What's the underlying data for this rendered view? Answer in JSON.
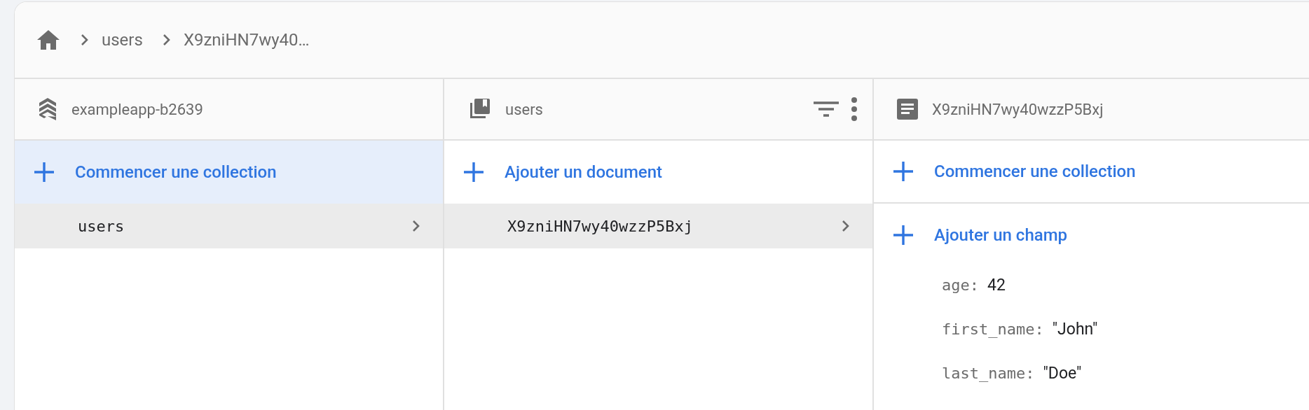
{
  "breadcrumb": [
    {
      "label": "users"
    },
    {
      "label": "X9zniHN7wy40…"
    }
  ],
  "columns": [
    {
      "kind": "project",
      "title": "exampleapp-b2639",
      "actions": [
        {
          "label": "Commencer une collection",
          "selected": true
        }
      ],
      "items": [
        {
          "label": "users",
          "selected": true
        }
      ]
    },
    {
      "kind": "collection",
      "title": "users",
      "actions": [
        {
          "label": "Ajouter un document",
          "selected": false
        }
      ],
      "items": [
        {
          "label": "X9zniHN7wy40wzzP5Bxj",
          "selected": true
        }
      ]
    },
    {
      "kind": "document",
      "title": "X9zniHN7wy40wzzP5Bxj",
      "actions": [
        {
          "label": "Commencer une collection",
          "selected": false
        },
        {
          "label": "Ajouter un champ",
          "selected": false
        }
      ],
      "fields": [
        {
          "key": "age:",
          "value": "42"
        },
        {
          "key": "first_name:",
          "value": "\"John\""
        },
        {
          "key": "last_name:",
          "value": "\"Doe\""
        }
      ]
    }
  ]
}
